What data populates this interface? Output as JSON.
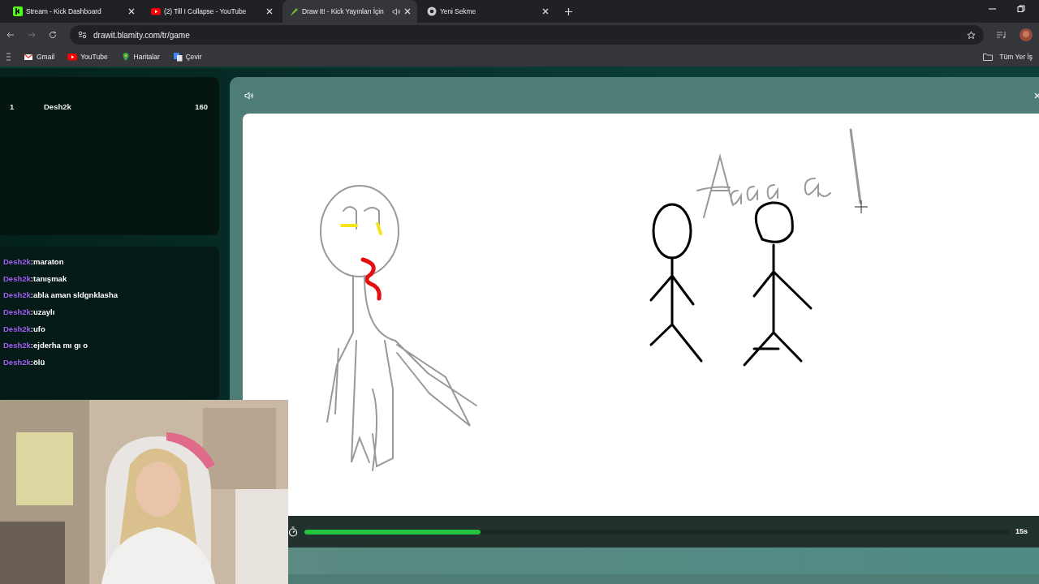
{
  "browser": {
    "tabs": [
      {
        "title": "Stream - Kick Dashboard",
        "kind": "kick",
        "selected": false,
        "audio": false
      },
      {
        "title": "(2) Till I Collapse - YouTube",
        "kind": "youtube",
        "selected": false,
        "audio": false
      },
      {
        "title": "Draw It! - Kick Yayınları İçin",
        "kind": "drawit",
        "selected": true,
        "audio": true
      },
      {
        "title": "Yeni Sekme",
        "kind": "chrome",
        "selected": false,
        "audio": false
      }
    ],
    "address": "drawit.blamity.com/tr/game",
    "bookmarks": [
      {
        "label": "Gmail",
        "kind": "gmail"
      },
      {
        "label": "YouTube",
        "kind": "youtube"
      },
      {
        "label": "Haritalar",
        "kind": "maps"
      },
      {
        "label": "Çevir",
        "kind": "translate"
      }
    ],
    "all_bookmarks": "Tüm Yer İş"
  },
  "leaderboard": [
    {
      "rank": "1",
      "name": "Desh2k",
      "score": "160"
    }
  ],
  "chat": [
    {
      "user": "Desh2k",
      "message": ":maraton"
    },
    {
      "user": "Desh2k",
      "message": ":tanışmak"
    },
    {
      "user": "Desh2k",
      "message": ":abla aman sldgnklasha"
    },
    {
      "user": "Desh2k",
      "message": ":uzaylı"
    },
    {
      "user": "Desh2k",
      "message": ":ufo"
    },
    {
      "user": "Desh2k",
      "message": ":ejderha mı gı o"
    },
    {
      "user": "Desh2k",
      "message": ":ölü"
    }
  ],
  "timer": {
    "level": 0.25,
    "label": "15s"
  }
}
